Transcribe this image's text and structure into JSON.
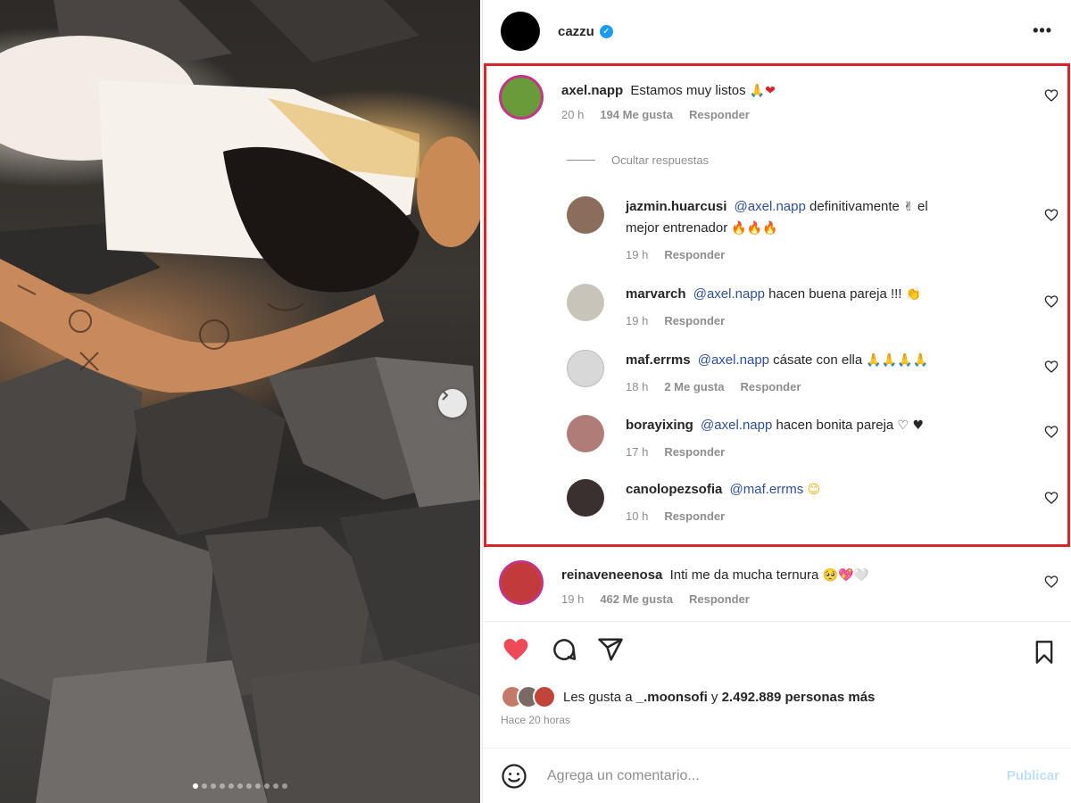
{
  "post": {
    "username": "cazzu",
    "more_glyph": "•••",
    "carousel": {
      "total": 11,
      "active_index": 0
    }
  },
  "comments": [
    {
      "username": "axel.napp",
      "mention": "",
      "text": "Estamos muy listos",
      "emoji": "🙏❤",
      "time": "20 h",
      "likes": "194 Me gusta",
      "reply": "Responder",
      "avatar_color": "#6a9b3a"
    }
  ],
  "hide_replies": "Ocultar respuestas",
  "replies": [
    {
      "username": "jazmin.huarcusi",
      "mention": "@axel.napp",
      "text": "definitivamente",
      "emoji": "✌",
      "text2": "el",
      "line2": "mejor entrenador",
      "emoji2": "🔥🔥🔥",
      "time": "19 h",
      "likes": "",
      "reply": "Responder",
      "avatar_color": "#8a6d5a"
    },
    {
      "username": "marvarch",
      "mention": "@axel.napp",
      "text": "hacen buena pareja !!!",
      "emoji": "👏",
      "time": "19 h",
      "likes": "",
      "reply": "Responder",
      "avatar_color": "#c9c4ba"
    },
    {
      "username": "maf.errms",
      "mention": "@axel.napp",
      "text": "cásate con ella",
      "emoji": "🙏🙏🙏🙏",
      "time": "18 h",
      "likes": "2 Me gusta",
      "reply": "Responder",
      "avatar_color": "#d8d8d8"
    },
    {
      "username": "borayixing",
      "mention": "@axel.napp",
      "text": "hacen bonita pareja",
      "emoji": "♡ ♥",
      "time": "17 h",
      "likes": "",
      "reply": "Responder",
      "avatar_color": "#b07c78"
    },
    {
      "username": "canolopezsofia",
      "mention": "@maf.errms",
      "text": "",
      "emoji": "😊",
      "time": "10 h",
      "likes": "",
      "reply": "Responder",
      "avatar_color": "#3b3030"
    }
  ],
  "next_comment": {
    "username": "reinaveneenosa",
    "text": "Inti me da mucha ternura",
    "emoji": "🥺💖🤍",
    "time": "19 h",
    "likes": "462 Me gusta",
    "reply": "Responder",
    "avatar_color": "#c23a3a"
  },
  "likes_summary": {
    "prefix": "Les gusta a",
    "user": "_.moonsofi",
    "middle": "y",
    "count": "2.492.889 personas más"
  },
  "time_ago": "Hace 20 horas",
  "comment_box": {
    "placeholder": "Agrega un comentario...",
    "publish_label": "Publicar"
  },
  "colors": {
    "like_red": "#ed4956",
    "highlight_border": "#d9252a",
    "mention_blue": "#2e4f9e"
  },
  "icons": {
    "like": "heart-filled-icon",
    "comment": "comment-icon",
    "share": "share-icon",
    "save": "bookmark-icon",
    "emoji": "emoji-icon"
  }
}
